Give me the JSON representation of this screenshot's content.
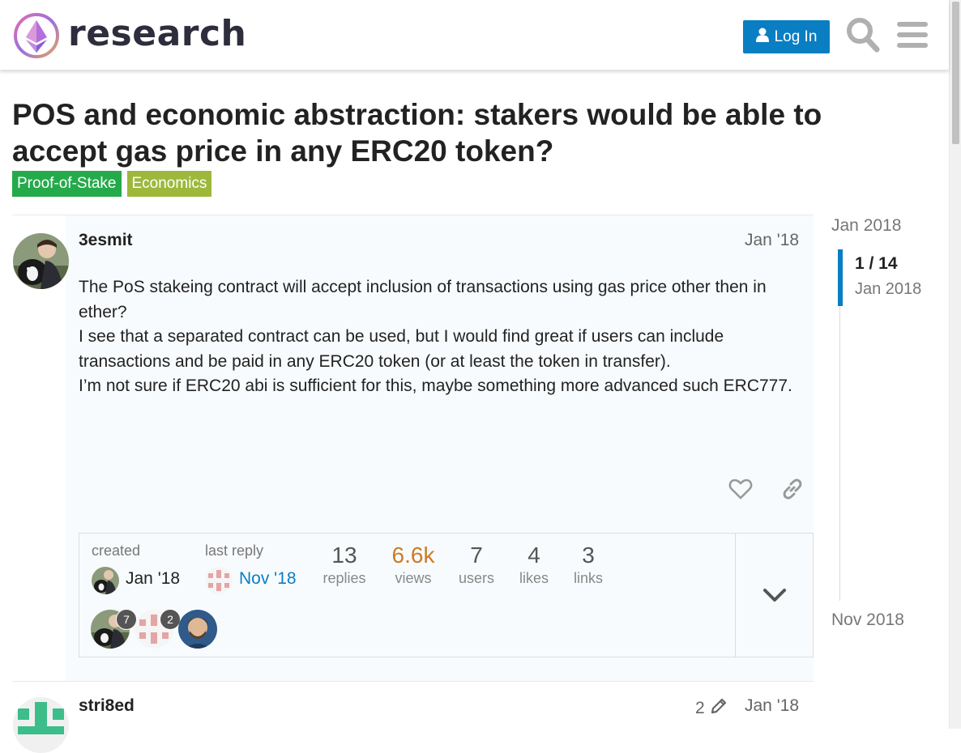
{
  "header": {
    "logo_text": "research",
    "login_label": "Log In"
  },
  "topic": {
    "title": "POS and economic abstraction: stakers would be able to accept gas price in any ERC20 token?",
    "tags": [
      {
        "label": "Proof-of-Stake",
        "color": "#25aa4b"
      },
      {
        "label": "Economics",
        "color": "#9eb83b"
      }
    ]
  },
  "post1": {
    "username": "3esmit",
    "date": "Jan '18",
    "paragraphs": [
      "The PoS stakeing contract will accept inclusion of transactions using gas price other then in ether?",
      "I see that a separated contract can be used, but I would find great if users can include transactions and be paid in any ERC20 token (or at least the token in transfer).",
      "I’m not sure if ERC20 abi is sufficient for this, maybe something more advanced such ERC777."
    ]
  },
  "topic_map": {
    "created_label": "created",
    "created_date": "Jan '18",
    "last_reply_label": "last reply",
    "last_reply_date": "Nov '18",
    "stats": [
      {
        "num": "13",
        "label": "replies"
      },
      {
        "num": "6.6k",
        "label": "views"
      },
      {
        "num": "7",
        "label": "users"
      },
      {
        "num": "4",
        "label": "likes"
      },
      {
        "num": "3",
        "label": "links"
      }
    ],
    "participants": [
      {
        "count": "7"
      },
      {
        "count": "2"
      }
    ]
  },
  "post2": {
    "username": "stri8ed",
    "edit_count": "2",
    "date": "Jan '18"
  },
  "timeline": {
    "start_label": "Jan 2018",
    "position": "1 / 14",
    "current_date": "Jan 2018",
    "end_label": "Nov 2018"
  },
  "colors": {
    "accent": "#0a7ec2",
    "views_highlight": "#cd7a25",
    "link_blue": "#0a7ec2"
  }
}
